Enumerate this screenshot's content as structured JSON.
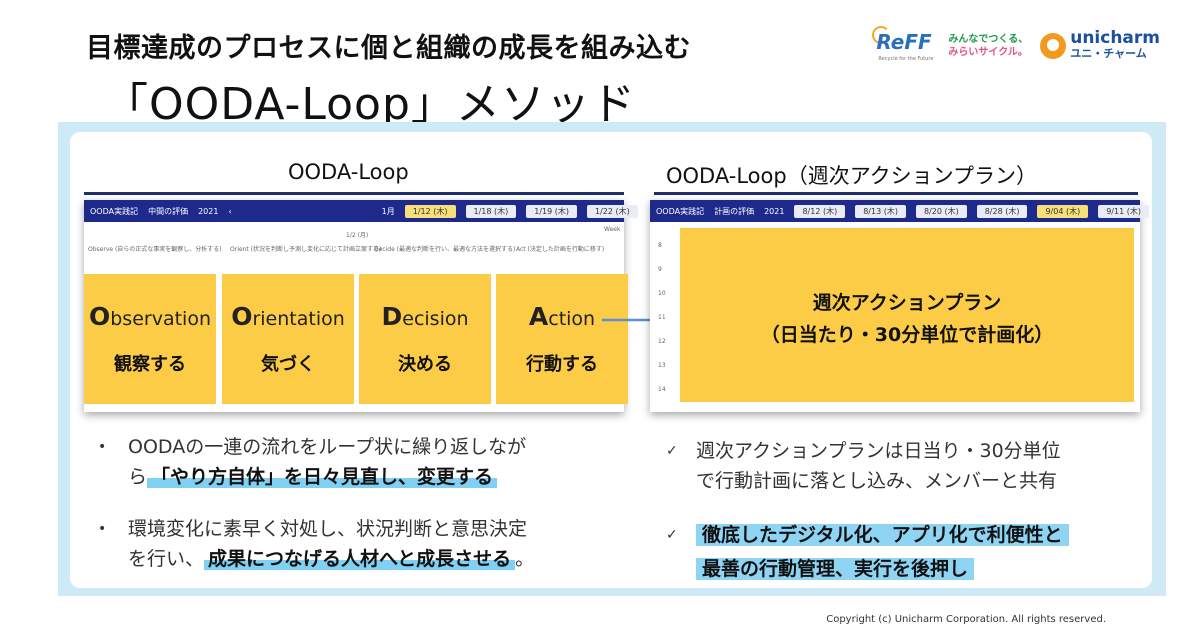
{
  "header": {
    "subtitle": "目標達成のプロセスに個と組織の成長を組み込む",
    "title": "「OODA-Loop」メソッド"
  },
  "logos": {
    "reff": "ReFF",
    "reff_sub": "Recycle for the Future",
    "tagline_1": "みんなでつくる、",
    "tagline_2": "みらいサイクル。",
    "unicharm_en": "unicharm",
    "unicharm_jp": "ユニ・チャーム"
  },
  "left_section": {
    "title": "OODA-Loop",
    "screen": {
      "app_name": "OODA実践記",
      "menu": "中間の評価",
      "year": "2021",
      "month": "1月",
      "tabs": [
        "1/12 (木)",
        "1/18 (木)",
        "1/19 (木)",
        "1/22 (木)"
      ],
      "view": "Week",
      "date_label": "1/2 (月)",
      "cols": [
        "Observe (自らの正式な事実を観察し、分析する)",
        "Orient (状況を判断し予測し変化に応じて計画立案する)",
        "Decide (最適な判断を行い、最適な方法を選択する)",
        "Act (決定した計画を行動に移す)"
      ]
    },
    "cards": [
      {
        "initial": "O",
        "rest": "bservation",
        "jp": "観察する"
      },
      {
        "initial": "O",
        "rest": "rientation",
        "jp": "気づく"
      },
      {
        "initial": "D",
        "rest": "ecision",
        "jp": "決める"
      },
      {
        "initial": "A",
        "rest": "ction",
        "jp": "行動する"
      }
    ]
  },
  "right_section": {
    "title": "OODA-Loop（週次アクションプラン）",
    "screen": {
      "app_name": "OODA実践記",
      "menu": "計画の評価",
      "year": "2021",
      "tabs": [
        "8/12 (木)",
        "8/13 (木)",
        "8/20 (木)",
        "8/28 (木)",
        "9/04 (木)",
        "9/11 (木)"
      ],
      "hours": [
        "8",
        "9",
        "10",
        "11",
        "12",
        "13",
        "14"
      ]
    },
    "plan_line1": "週次アクションプラン",
    "plan_line2": "（日当たり・30分単位で計画化）"
  },
  "bullets_left": [
    {
      "marker": "•",
      "line1": "OODAの一連の流れをループ状に繰り返しなが",
      "line2_pre": "ら",
      "line2_hl": "「やり方自体」を日々見直し、変更する",
      "line2_post": ""
    },
    {
      "marker": "•",
      "line1": "環境変化に素早く対処し、状況判断と意思決定",
      "line2_pre": "を行い、",
      "line2_hl": "成果につなげる人材へと成長させる",
      "line2_post": "。"
    }
  ],
  "bullets_right": [
    {
      "marker": "✓",
      "line1": "週次アクションプランは日当り・30分単位",
      "line2": "で行動計画に落とし込み、メンバーと共有"
    },
    {
      "marker": "✓",
      "line1": "徹底したデジタル化、アプリ化で利便性と",
      "line2": "最善の行動管理、実行を後押し"
    }
  ],
  "footer": {
    "copyright": "Copyright (c) Unicharm Corporation. All rights reserved."
  },
  "colors": {
    "accent_yellow": "#fdcc47",
    "panel_blue": "#cfe9f7",
    "highlight_blue": "#8fd5f3",
    "nav_blue": "#1d2a8c",
    "arrow_blue": "#5b8fd6"
  }
}
